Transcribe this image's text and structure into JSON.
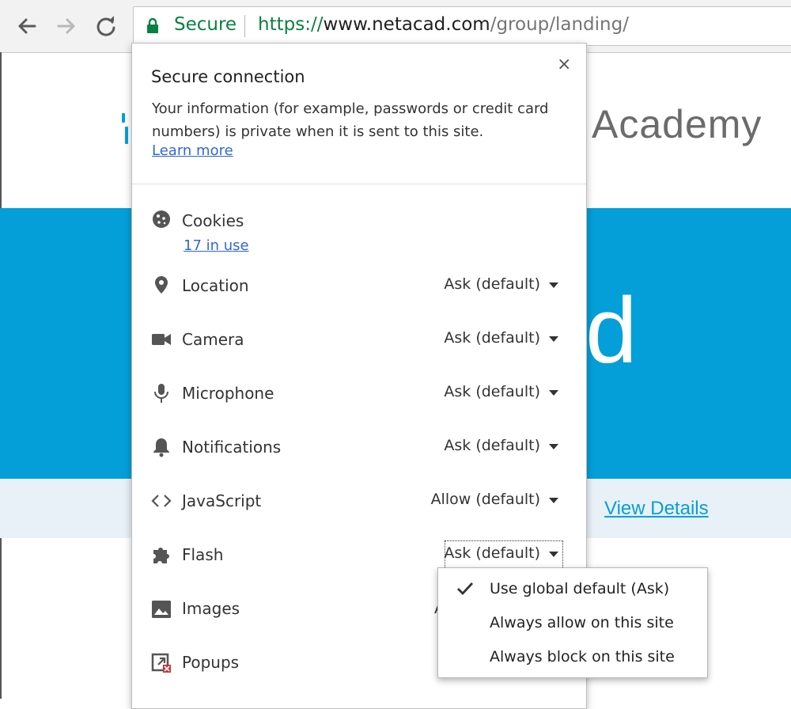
{
  "browser": {
    "nav": {
      "back_icon": "back-arrow-icon",
      "forward_icon": "forward-arrow-icon",
      "reload_icon": "reload-icon"
    },
    "omnibox": {
      "security_label": "Secure",
      "url_scheme": "https://",
      "url_host": "www.netacad.com",
      "url_path": "/group/landing/"
    },
    "colors": {
      "secure_green": "#0b8043",
      "toolbar_bg": "#f2f2f2"
    }
  },
  "webpage": {
    "header_word": "Academy",
    "hero_text": "d",
    "view_details": "View Details",
    "colors": {
      "brand_blue": "#049fd9",
      "strip_bg": "#e8f1f7"
    }
  },
  "site_info": {
    "close_symbol": "×",
    "title": "Secure connection",
    "description": "Your information (for example, passwords or credit card numbers) is private when it is sent to this site.",
    "learn_more": "Learn more",
    "cookies": {
      "label": "Cookies",
      "link": "17 in use",
      "icon": "cookie-icon"
    },
    "permissions": [
      {
        "label": "Location",
        "value": "Ask (default)",
        "icon": "location-pin-icon"
      },
      {
        "label": "Camera",
        "value": "Ask (default)",
        "icon": "camera-icon"
      },
      {
        "label": "Microphone",
        "value": "Ask (default)",
        "icon": "microphone-icon"
      },
      {
        "label": "Notifications",
        "value": "Ask (default)",
        "icon": "bell-icon"
      },
      {
        "label": "JavaScript",
        "value": "Allow (default)",
        "icon": "code-icon"
      },
      {
        "label": "Flash",
        "value": "Ask (default)",
        "icon": "puzzle-icon"
      },
      {
        "label": "Images",
        "value": "A",
        "icon": "image-icon"
      },
      {
        "label": "Popups",
        "value": "",
        "icon": "popup-blocked-icon"
      }
    ],
    "link_color": "#3367d6"
  },
  "flash_menu": {
    "selected_index": 0,
    "items": [
      {
        "label": "Use global default (Ask)",
        "checked": true
      },
      {
        "label": "Always allow on this site",
        "checked": false
      },
      {
        "label": "Always block on this site",
        "checked": false
      }
    ]
  }
}
